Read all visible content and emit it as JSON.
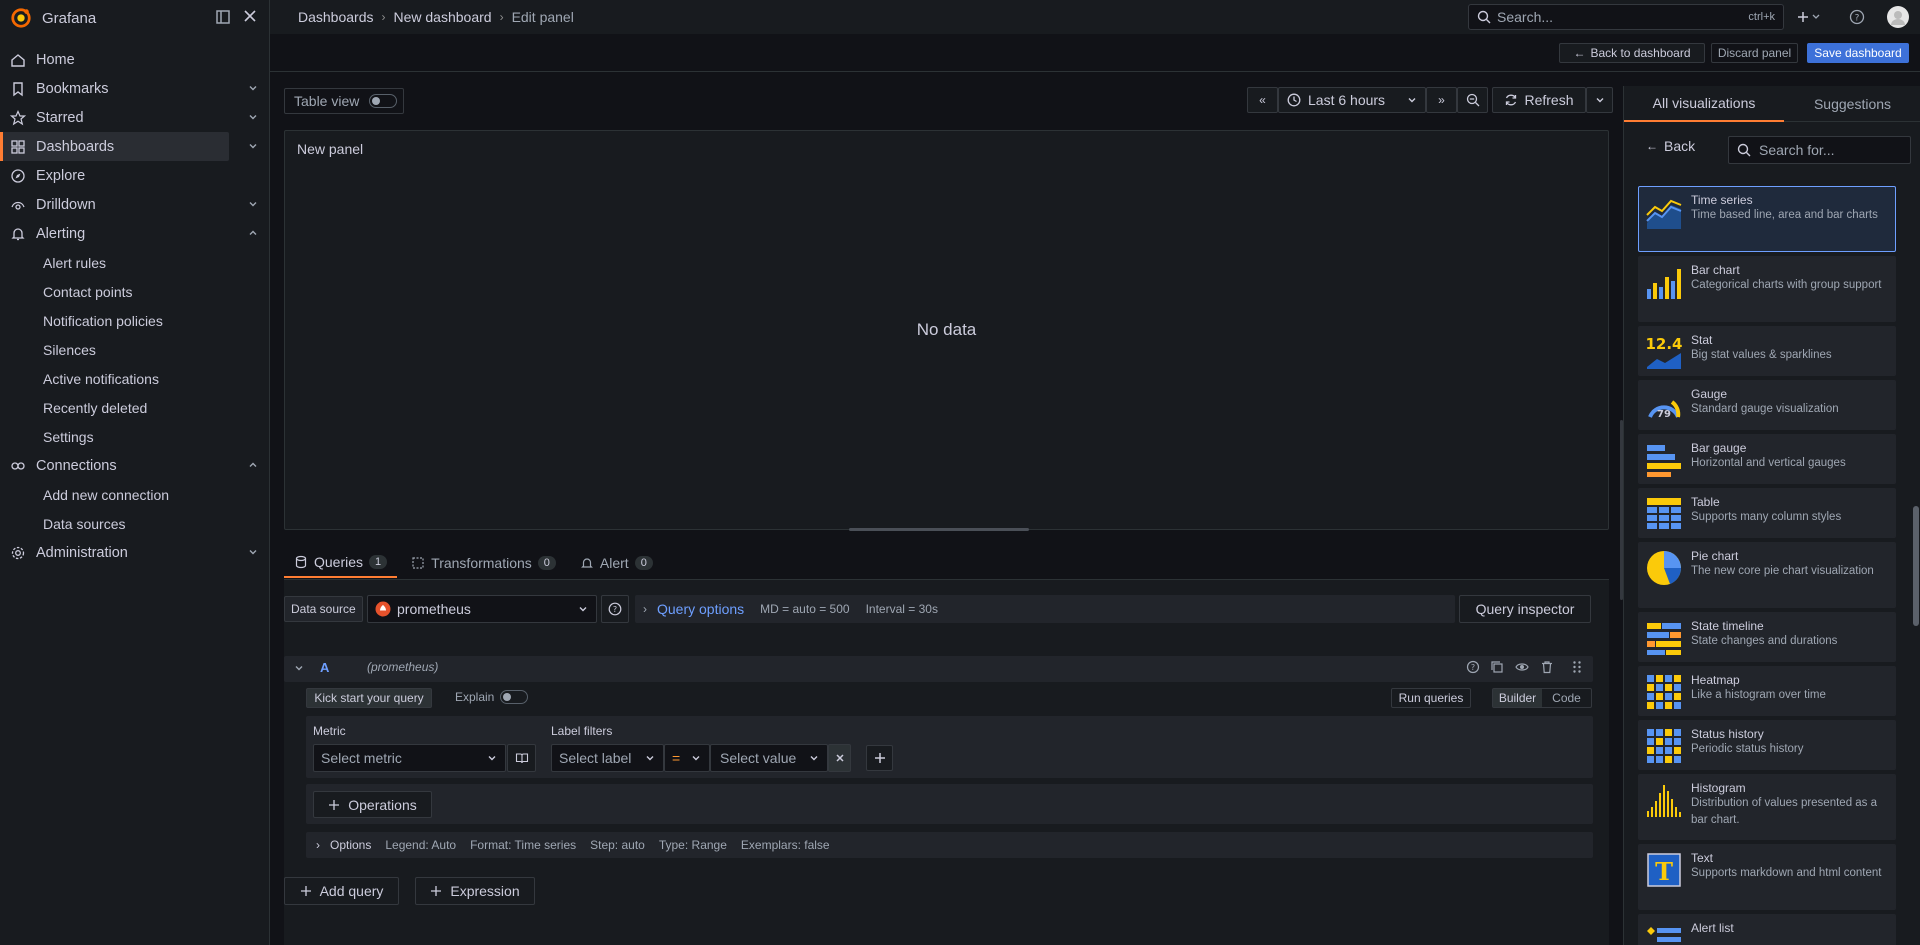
{
  "app": {
    "name": "Grafana"
  },
  "breadcrumbs": [
    "Dashboards",
    "New dashboard",
    "Edit panel"
  ],
  "top_search": {
    "placeholder": "Search...",
    "shortcut": "ctrl+k"
  },
  "nav": {
    "items": [
      {
        "label": "Home"
      },
      {
        "label": "Bookmarks"
      },
      {
        "label": "Starred"
      },
      {
        "label": "Dashboards"
      },
      {
        "label": "Explore"
      },
      {
        "label": "Drilldown"
      },
      {
        "label": "Alerting"
      }
    ],
    "alerting_sub": [
      "Alert rules",
      "Contact points",
      "Notification policies",
      "Silences",
      "Active notifications",
      "Recently deleted",
      "Settings"
    ],
    "connections": "Connections",
    "connections_sub": [
      "Add new connection",
      "Data sources"
    ],
    "administration": "Administration"
  },
  "actions": {
    "back": "Back to dashboard",
    "discard": "Discard panel",
    "save": "Save dashboard"
  },
  "panel_toolbar": {
    "table_view": "Table view",
    "time_range": "Last 6 hours",
    "refresh": "Refresh"
  },
  "panel": {
    "title": "New panel",
    "empty": "No data"
  },
  "tabs": [
    {
      "label": "Queries",
      "count": "1"
    },
    {
      "label": "Transformations",
      "count": "0"
    },
    {
      "label": "Alert",
      "count": "0"
    }
  ],
  "query": {
    "datasource_label": "Data source",
    "datasource": "prometheus",
    "query_options": "Query options",
    "md": "MD = auto = 500",
    "interval": "Interval = 30s",
    "inspector": "Query inspector",
    "ref": "A",
    "ref_ds": "(prometheus)",
    "kickstart": "Kick start your query",
    "explain": "Explain",
    "run": "Run queries",
    "builder": "Builder",
    "code": "Code",
    "metric_label": "Metric",
    "metric_placeholder": "Select metric",
    "label_filters": "Label filters",
    "select_label": "Select label",
    "op": "=",
    "select_value": "Select value",
    "operations": "Operations",
    "options": "Options",
    "legend": "Legend: Auto",
    "format": "Format: Time series",
    "step": "Step: auto",
    "type": "Type: Range",
    "exemplars": "Exemplars: false",
    "add_query": "Add query",
    "expression": "Expression"
  },
  "viz": {
    "tab_all": "All visualizations",
    "tab_suggest": "Suggestions",
    "back": "Back",
    "search_placeholder": "Search for...",
    "items": [
      {
        "name": "Time series",
        "desc": "Time based line, area and bar charts"
      },
      {
        "name": "Bar chart",
        "desc": "Categorical charts with group support"
      },
      {
        "name": "Stat",
        "desc": "Big stat values & sparklines"
      },
      {
        "name": "Gauge",
        "desc": "Standard gauge visualization"
      },
      {
        "name": "Bar gauge",
        "desc": "Horizontal and vertical gauges"
      },
      {
        "name": "Table",
        "desc": "Supports many column styles"
      },
      {
        "name": "Pie chart",
        "desc": "The new core pie chart visualization"
      },
      {
        "name": "State timeline",
        "desc": "State changes and durations"
      },
      {
        "name": "Heatmap",
        "desc": "Like a histogram over time"
      },
      {
        "name": "Status history",
        "desc": "Periodic status history"
      },
      {
        "name": "Histogram",
        "desc": "Distribution of values presented as a bar chart."
      },
      {
        "name": "Text",
        "desc": "Supports markdown and html content"
      },
      {
        "name": "Alert list",
        "desc": ""
      }
    ],
    "thumb_text": {
      "stat": "12.4",
      "gauge": "79",
      "text": "T"
    }
  },
  "colors": {
    "accent": "#ff7d33",
    "primary": "#3d71d9",
    "selected_border": "#6e9fff"
  }
}
